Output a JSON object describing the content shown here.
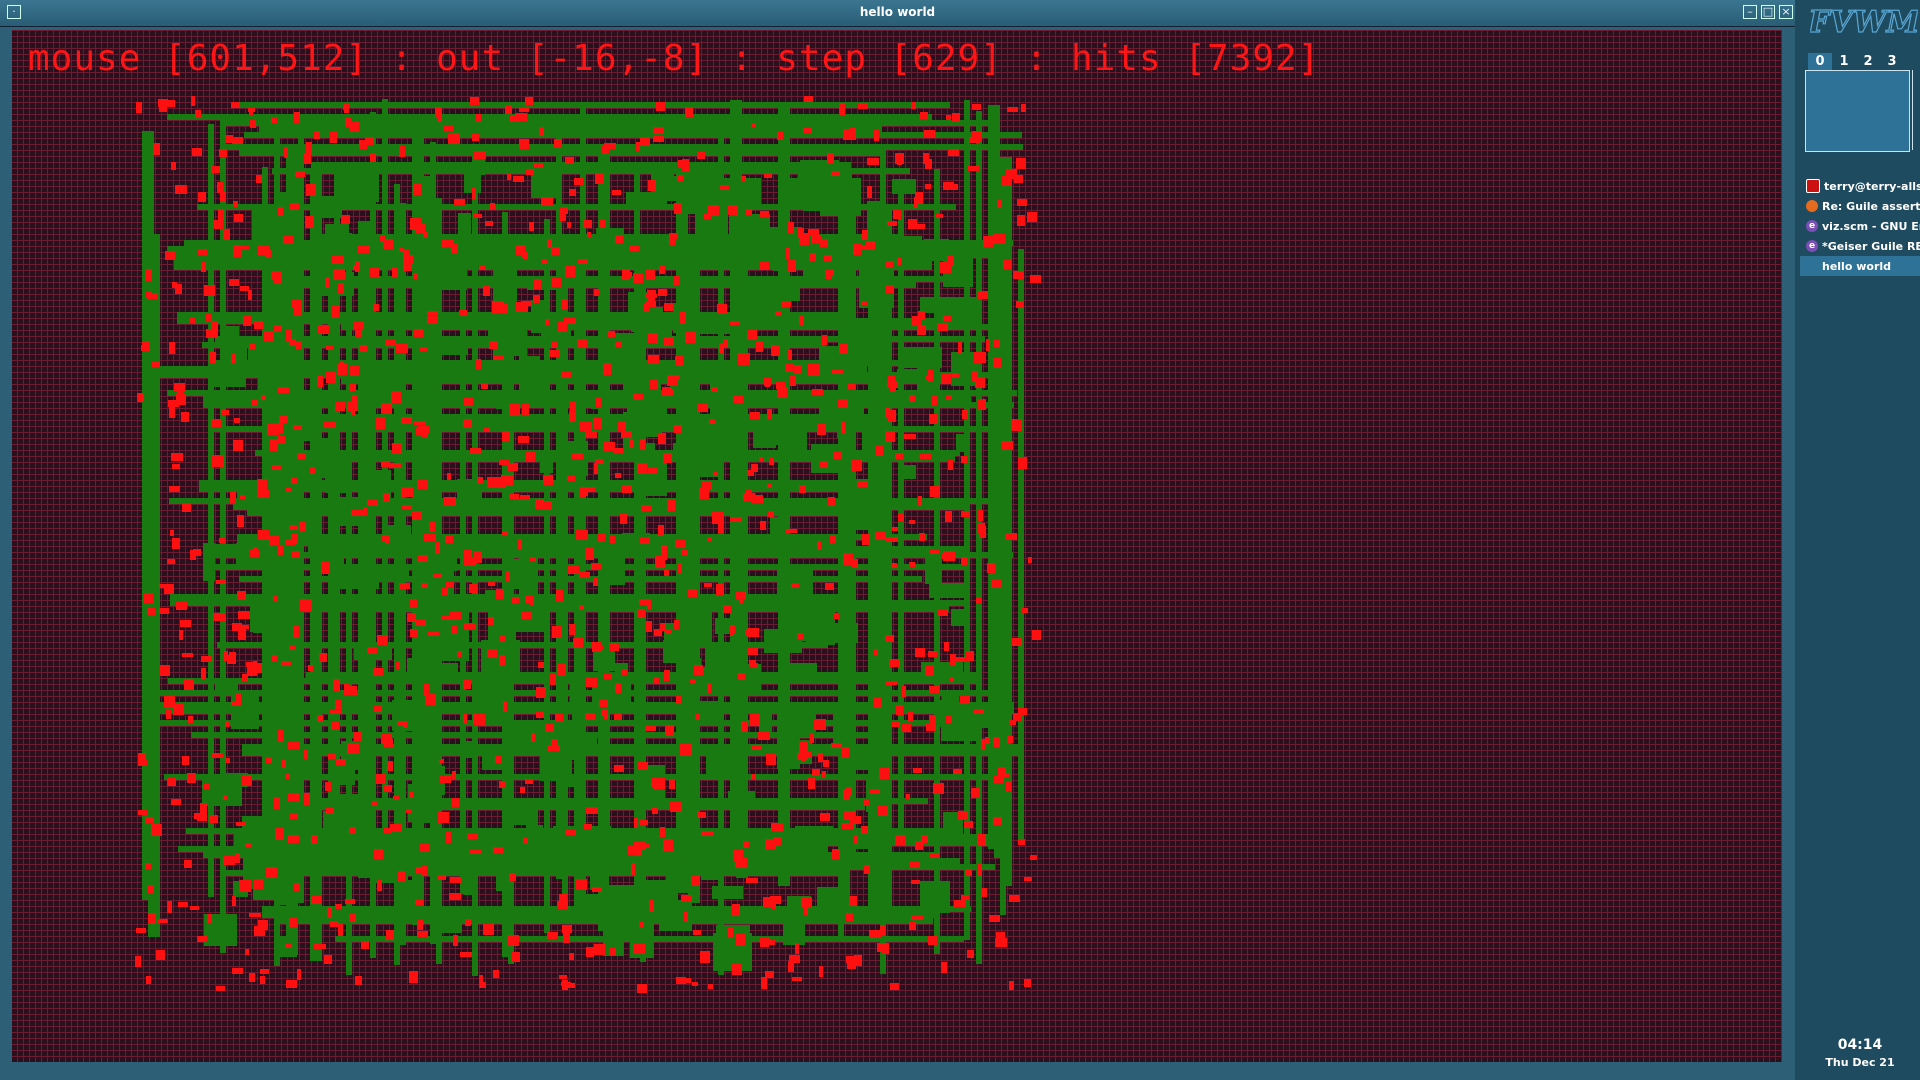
{
  "window": {
    "title": "hello world",
    "status_text": "mouse [601,512] : out [-16,-8] : step [629] : hits [7392]"
  },
  "viz": {
    "background_color": "#2a0f1c",
    "grid_color": "#6b1b32",
    "path_color": "#1a7a12",
    "hit_color": "#ff1010",
    "text_color": "#ff1515"
  },
  "sidebar": {
    "logo": "FVWM",
    "desks": [
      "0",
      "1",
      "2",
      "3"
    ],
    "active_desk": 0,
    "tasks": [
      {
        "label": "terry@terry-allser",
        "icon": "terminal-icon"
      },
      {
        "label": "Re: Guile assert m",
        "icon": "firefox-icon"
      },
      {
        "label": "viz.scm - GNU Em",
        "icon": "emacs-icon"
      },
      {
        "label": "*Geiser Guile REPL",
        "icon": "emacs-icon"
      },
      {
        "label": "hello world",
        "icon": ""
      }
    ],
    "clock": "04:14",
    "date": "Thu Dec 21"
  }
}
